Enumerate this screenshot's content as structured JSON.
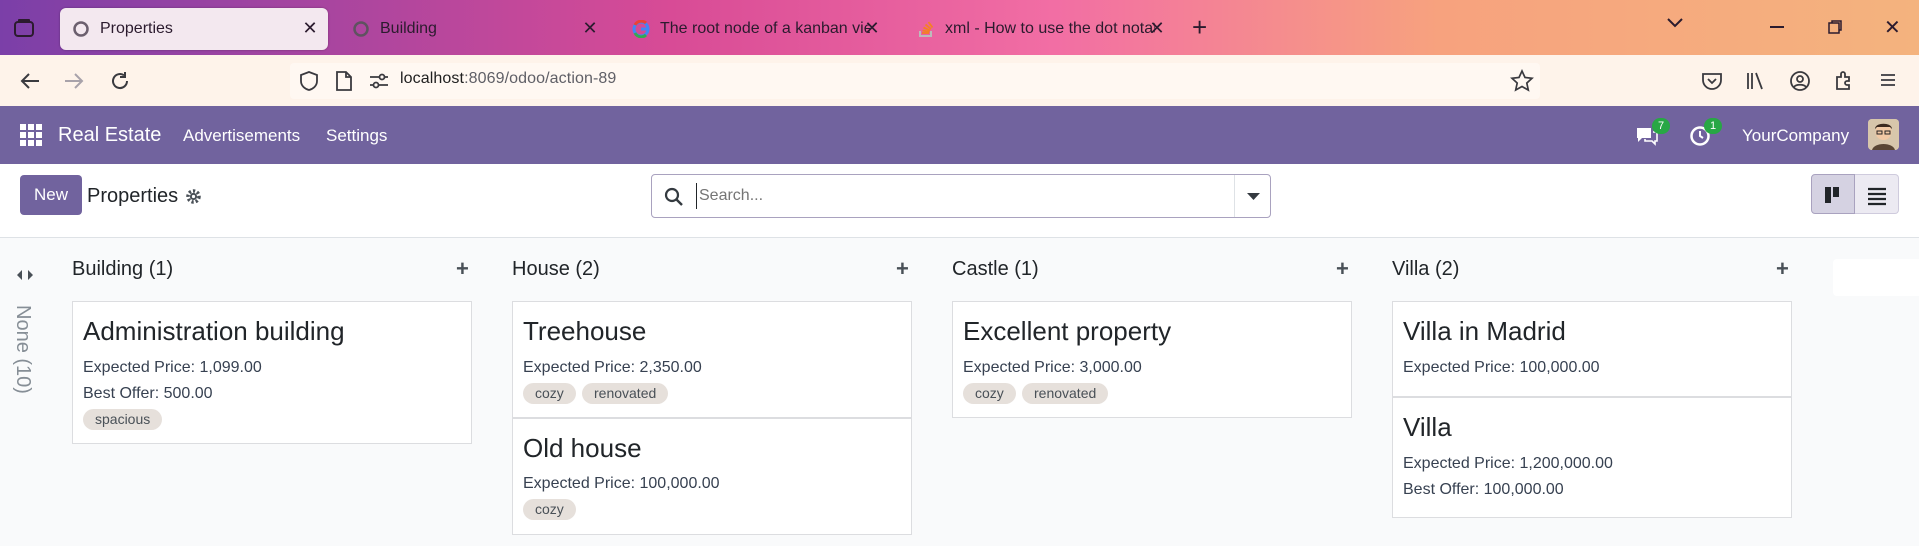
{
  "browser": {
    "tabs": [
      {
        "title": "Properties",
        "active": true,
        "icon": "odoo-icon"
      },
      {
        "title": "Building",
        "active": false,
        "icon": "odoo-icon"
      },
      {
        "title": "The root node of a kanban view",
        "active": false,
        "icon": "google-icon"
      },
      {
        "title": "xml - How to use the dot notati",
        "active": false,
        "icon": "stackoverflow-icon"
      }
    ],
    "url_host": "localhost",
    "url_rest": ":8069/odoo/action-89"
  },
  "app": {
    "name": "Real Estate",
    "menu": [
      "Advertisements",
      "Settings"
    ],
    "messages_count": "7",
    "activities_count": "1",
    "company": "YourCompany"
  },
  "control": {
    "new_label": "New",
    "breadcrumb": "Properties",
    "search_placeholder": "Search..."
  },
  "kanban": {
    "folded_label": "None (10)",
    "columns": [
      {
        "title": "Building (1)",
        "cards": [
          {
            "name": "Administration building",
            "lines": [
              "Expected Price: 1,099.00",
              "Best Offer: 500.00"
            ],
            "tags": [
              "spacious"
            ]
          }
        ]
      },
      {
        "title": "House (2)",
        "cards": [
          {
            "name": "Treehouse",
            "lines": [
              "Expected Price: 2,350.00"
            ],
            "tags": [
              "cozy",
              "renovated"
            ]
          },
          {
            "name": "Old house",
            "lines": [
              "Expected Price: 100,000.00"
            ],
            "tags": [
              "cozy"
            ]
          }
        ]
      },
      {
        "title": "Castle (1)",
        "cards": [
          {
            "name": "Excellent property",
            "lines": [
              "Expected Price: 3,000.00"
            ],
            "tags": [
              "cozy",
              "renovated"
            ]
          }
        ]
      },
      {
        "title": "Villa (2)",
        "cards": [
          {
            "name": "Villa in Madrid",
            "lines": [
              "Expected Price: 100,000.00"
            ],
            "tags": []
          },
          {
            "name": "Villa",
            "lines": [
              "Expected Price: 1,200,000.00",
              "Best Offer: 100,000.00"
            ],
            "tags": []
          }
        ]
      }
    ]
  },
  "colors": {
    "brand": "#71639e",
    "badge": "#28a745"
  }
}
